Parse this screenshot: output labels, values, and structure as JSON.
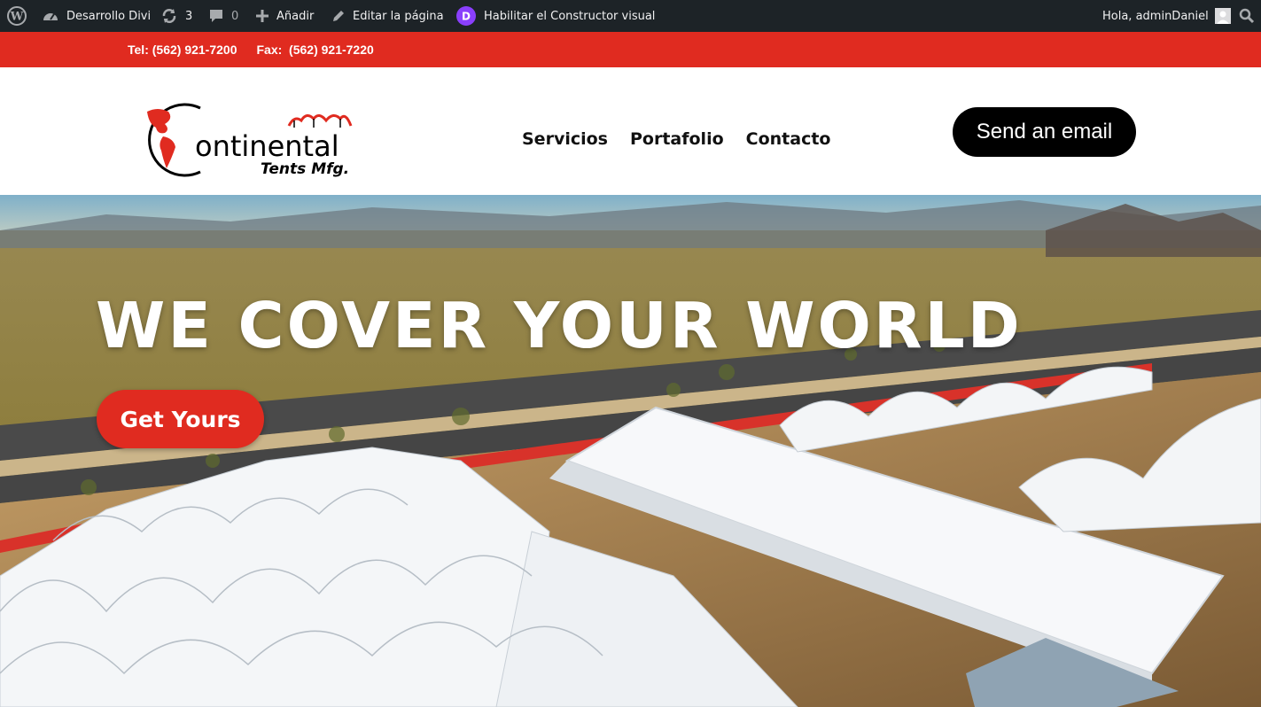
{
  "admin_bar": {
    "site_name": "Desarrollo Divi",
    "updates_count": "3",
    "comments_count": "0",
    "add_new": "Añadir",
    "edit_page": "Editar la página",
    "visual_builder": "Habilitar el Constructor visual",
    "greeting": "Hola, adminDaniel"
  },
  "top_bar": {
    "phone": "Tel: (562) 921-7200",
    "fax": "Fax:  (562) 921-7220"
  },
  "header": {
    "logo_text_main": "ontinental",
    "logo_text_sub": "Tents Mfg.",
    "nav": [
      "Servicios",
      "Portafolio",
      "Contacto"
    ],
    "email_button": "Send an email"
  },
  "hero": {
    "title": "WE COVER YOUR WORLD",
    "cta": "Get Yours"
  },
  "colors": {
    "brand_red": "#e02b20",
    "admin_bar": "#1d2327",
    "divi_purple": "#8a3ffc"
  },
  "icons": [
    "wordpress-icon",
    "dashboard-icon",
    "updates-icon",
    "comment-icon",
    "plus-icon",
    "pencil-icon",
    "divi-icon",
    "avatar",
    "search-icon",
    "globe-icon"
  ]
}
